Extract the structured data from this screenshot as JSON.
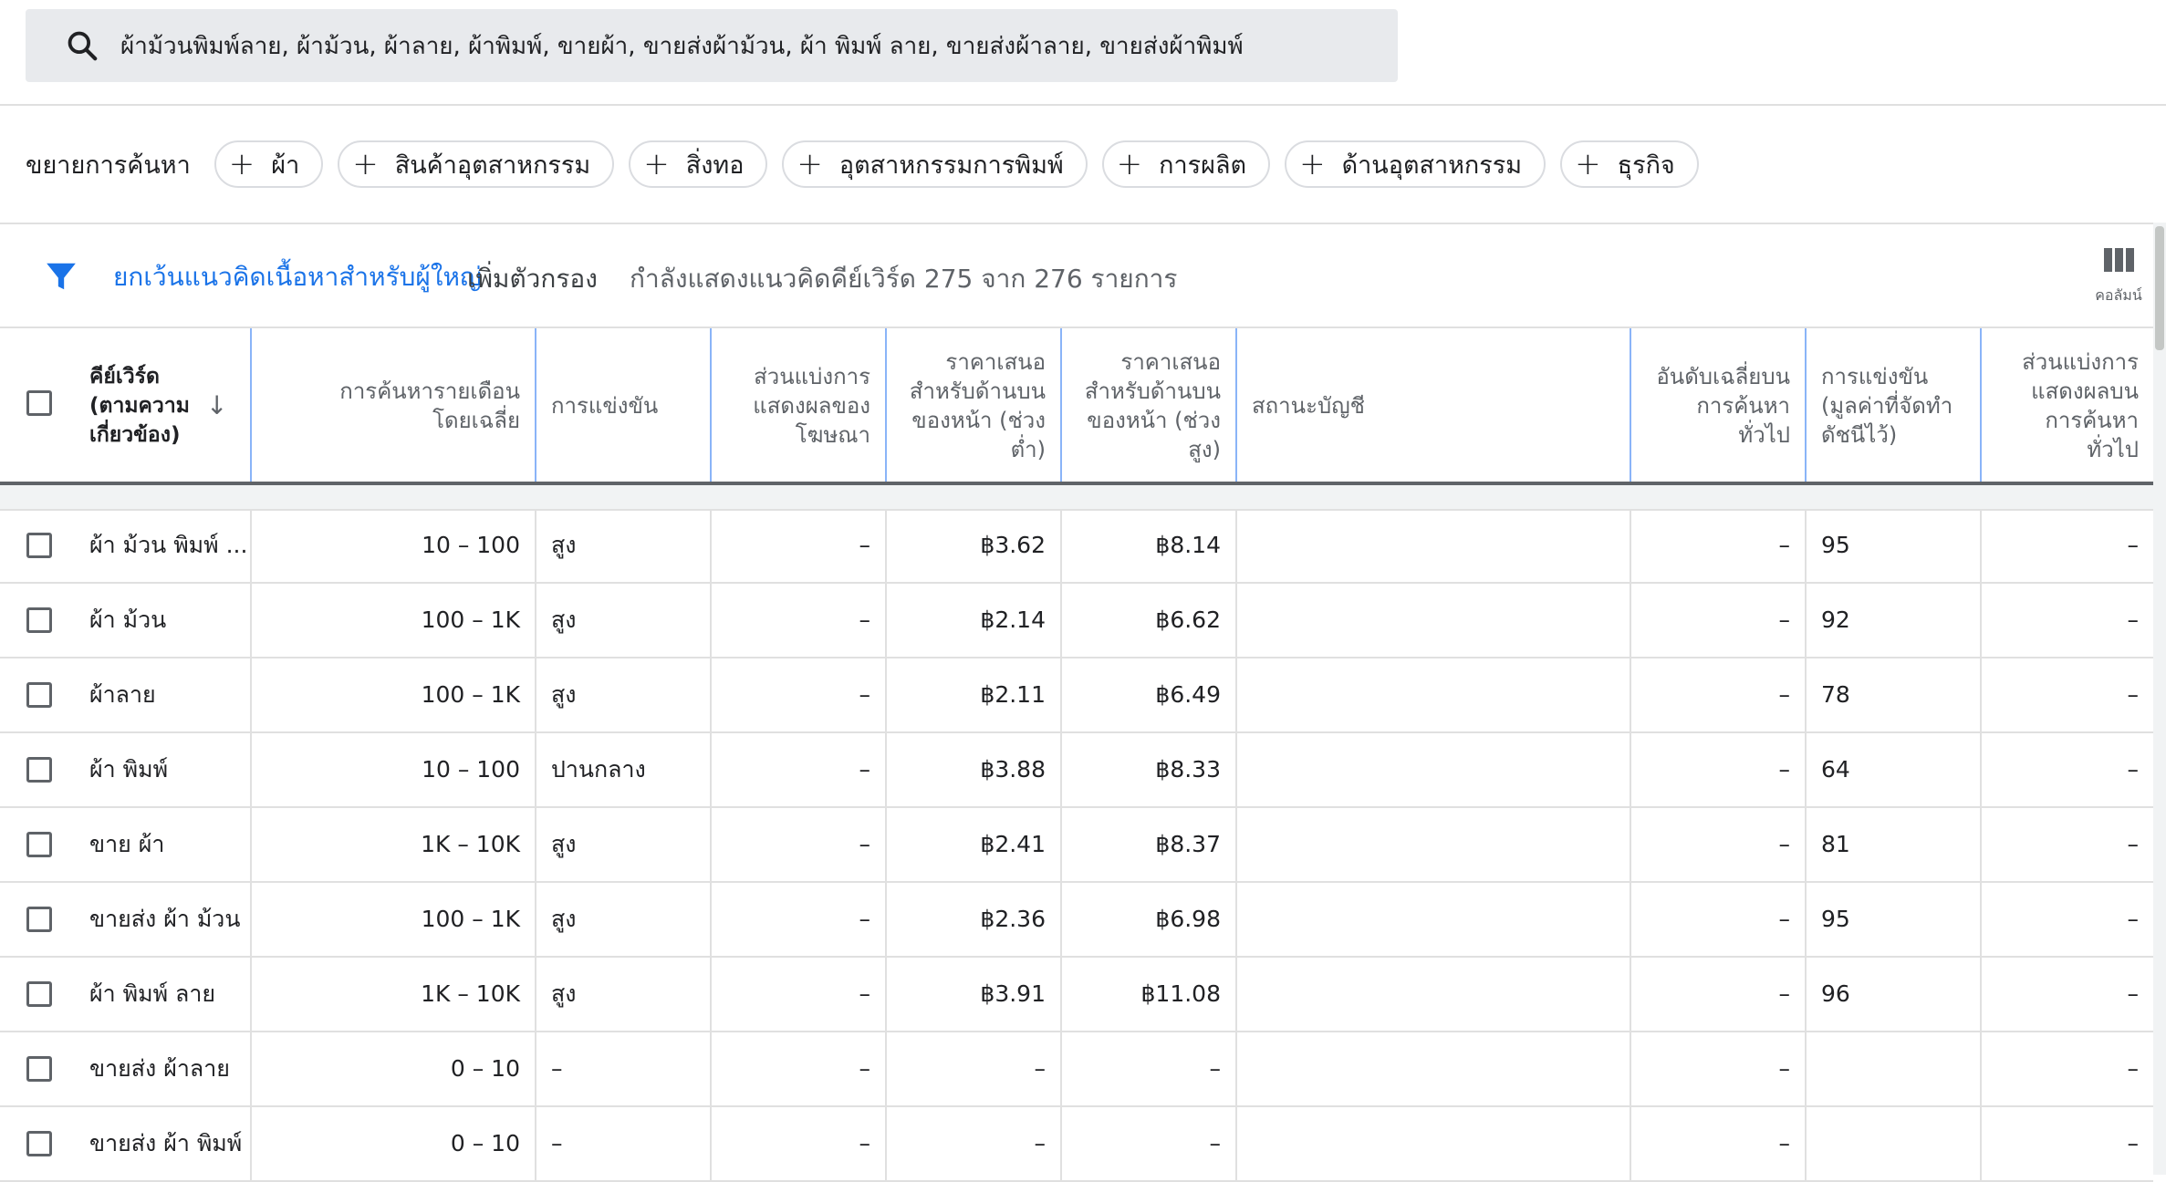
{
  "search": {
    "icon": "search-icon",
    "query": "ผ้าม้วนพิมพ์ลาย, ผ้าม้วน, ผ้าลาย, ผ้าพิมพ์, ขายผ้า, ขายส่งผ้าม้วน, ผ้า พิมพ์ ลาย, ขายส่งผ้าลาย, ขายส่งผ้าพิมพ์"
  },
  "expand": {
    "label": "ขยายการค้นหา",
    "chips": [
      "ผ้า",
      "สินค้าอุตสาหกรรม",
      "สิ่งทอ",
      "อุตสาหกรรมการพิมพ์",
      "การผลิต",
      "ด้านอุตสาหกรรม",
      "ธุรกิจ"
    ]
  },
  "filters": {
    "icon": "filter-icon",
    "active_filter": "ยกเว้นแนวคิดเนื้อหาสำหรับผู้ใหญ่",
    "add_filter": "เพิ่มตัวกรอง",
    "showing": "กำลังแสดงแนวคิดคีย์เวิร์ด 275 จาก 276 รายการ",
    "columns_label": "คอลัมน์",
    "columns_icon": "columns-icon"
  },
  "table": {
    "headers": {
      "keyword": "คีย์เวิร์ด (ตามความเกี่ยวข้อง)",
      "monthly": "การค้นหารายเดือนโดยเฉลี่ย",
      "competition": "การแข่งขัน",
      "ad_share": "ส่วนแบ่งการแสดงผลของโฆษณา",
      "bid_low": "ราคาเสนอสำหรับด้านบนของหน้า (ช่วงต่ำ)",
      "bid_high": "ราคาเสนอสำหรับด้านบนของหน้า (ช่วงสูง)",
      "account_status": "สถานะบัญชี",
      "organic_rank": "อันดับเฉลี่ยบนการค้นหาทั่วไป",
      "competition_index": "การแข่งขัน (มูลค่าที่จัดทำดัชนีไว้)",
      "organic_share": "ส่วนแบ่งการแสดงผลบนการค้นหาทั่วไป"
    },
    "rows": [
      {
        "keyword": "ผ้า ม้วน พิมพ์ ...",
        "monthly": "10 – 100",
        "competition": "สูง",
        "ad_share": "–",
        "bid_low": "฿3.62",
        "bid_high": "฿8.14",
        "status": "",
        "rank": "–",
        "index": "95",
        "organic_share": "–"
      },
      {
        "keyword": "ผ้า ม้วน",
        "monthly": "100 – 1K",
        "competition": "สูง",
        "ad_share": "–",
        "bid_low": "฿2.14",
        "bid_high": "฿6.62",
        "status": "",
        "rank": "–",
        "index": "92",
        "organic_share": "–"
      },
      {
        "keyword": "ผ้าลาย",
        "monthly": "100 – 1K",
        "competition": "สูง",
        "ad_share": "–",
        "bid_low": "฿2.11",
        "bid_high": "฿6.49",
        "status": "",
        "rank": "–",
        "index": "78",
        "organic_share": "–"
      },
      {
        "keyword": "ผ้า พิมพ์",
        "monthly": "10 – 100",
        "competition": "ปานกลาง",
        "ad_share": "–",
        "bid_low": "฿3.88",
        "bid_high": "฿8.33",
        "status": "",
        "rank": "–",
        "index": "64",
        "organic_share": "–"
      },
      {
        "keyword": "ขาย ผ้า",
        "monthly": "1K – 10K",
        "competition": "สูง",
        "ad_share": "–",
        "bid_low": "฿2.41",
        "bid_high": "฿8.37",
        "status": "",
        "rank": "–",
        "index": "81",
        "organic_share": "–"
      },
      {
        "keyword": "ขายส่ง ผ้า ม้วน",
        "monthly": "100 – 1K",
        "competition": "สูง",
        "ad_share": "–",
        "bid_low": "฿2.36",
        "bid_high": "฿6.98",
        "status": "",
        "rank": "–",
        "index": "95",
        "organic_share": "–"
      },
      {
        "keyword": "ผ้า พิมพ์ ลาย",
        "monthly": "1K – 10K",
        "competition": "สูง",
        "ad_share": "–",
        "bid_low": "฿3.91",
        "bid_high": "฿11.08",
        "status": "",
        "rank": "–",
        "index": "96",
        "organic_share": "–"
      },
      {
        "keyword": "ขายส่ง ผ้าลาย",
        "monthly": "0 – 10",
        "competition": "–",
        "ad_share": "–",
        "bid_low": "–",
        "bid_high": "–",
        "status": "",
        "rank": "–",
        "index": "",
        "organic_share": "–"
      },
      {
        "keyword": "ขายส่ง ผ้า พิมพ์",
        "monthly": "0 – 10",
        "competition": "–",
        "ad_share": "–",
        "bid_low": "–",
        "bid_high": "–",
        "status": "",
        "rank": "–",
        "index": "",
        "organic_share": "–"
      }
    ]
  }
}
